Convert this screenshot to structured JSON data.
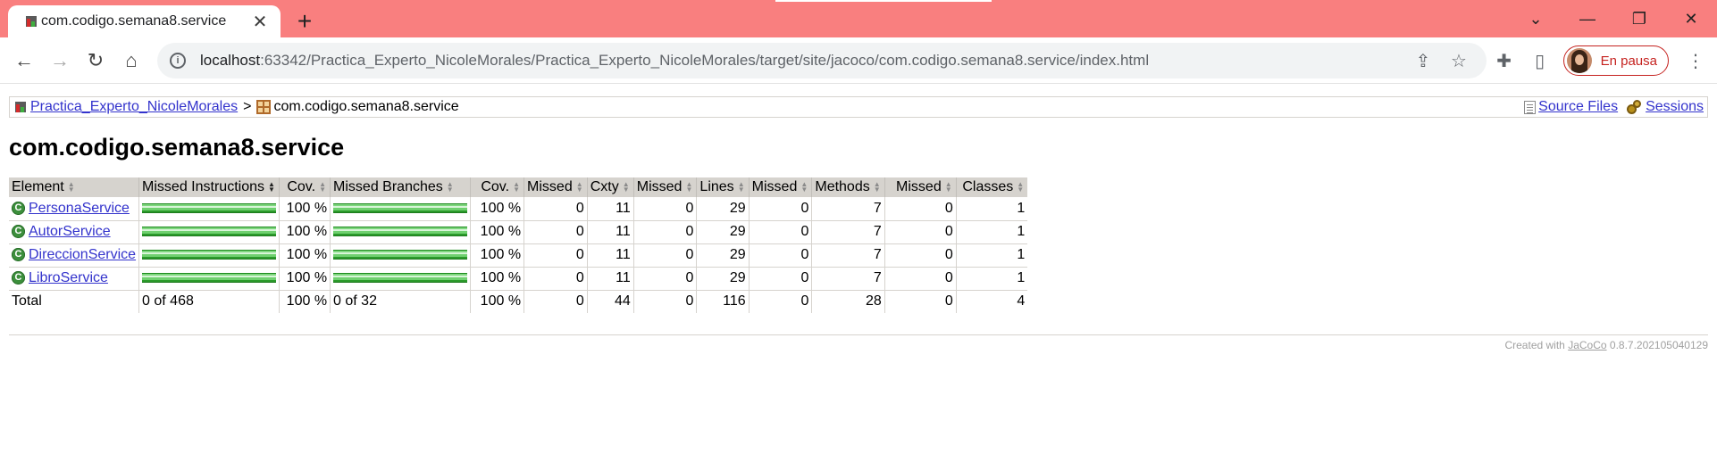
{
  "browser": {
    "tab_title": "com.codigo.semana8.service",
    "url_host": "localhost",
    "url_rest": ":63342/Practica_Experto_NicoleMorales/Practica_Experto_NicoleMorales/target/site/jacoco/com.codigo.semana8.service/index.html",
    "profile_status": "En pausa",
    "accent_color": "#f97f7f"
  },
  "breadcrumb": {
    "root": "Practica_Experto_NicoleMorales",
    "separator": ">",
    "current": "com.codigo.semana8.service",
    "source_files": "Source Files",
    "sessions": "Sessions"
  },
  "title": "com.codigo.semana8.service",
  "table": {
    "headers": [
      "Element",
      "Missed Instructions",
      "Cov.",
      "Missed Branches",
      "Cov.",
      "Missed",
      "Cxty",
      "Missed",
      "Lines",
      "Missed",
      "Methods",
      "Missed",
      "Classes"
    ],
    "rows": [
      {
        "name": "PersonaService",
        "instr_cov_fraction": 1.0,
        "instr_cov": "100 %",
        "branch_cov_fraction": 1.0,
        "branch_cov": "100 %",
        "missed_cxty": "0",
        "cxty": "11",
        "missed_lines": "0",
        "lines": "29",
        "missed_methods": "0",
        "methods": "7",
        "missed_classes": "0",
        "classes": "1"
      },
      {
        "name": "AutorService",
        "instr_cov_fraction": 1.0,
        "instr_cov": "100 %",
        "branch_cov_fraction": 1.0,
        "branch_cov": "100 %",
        "missed_cxty": "0",
        "cxty": "11",
        "missed_lines": "0",
        "lines": "29",
        "missed_methods": "0",
        "methods": "7",
        "missed_classes": "0",
        "classes": "1"
      },
      {
        "name": "DireccionService",
        "instr_cov_fraction": 1.0,
        "instr_cov": "100 %",
        "branch_cov_fraction": 1.0,
        "branch_cov": "100 %",
        "missed_cxty": "0",
        "cxty": "11",
        "missed_lines": "0",
        "lines": "29",
        "missed_methods": "0",
        "methods": "7",
        "missed_classes": "0",
        "classes": "1"
      },
      {
        "name": "LibroService",
        "instr_cov_fraction": 1.0,
        "instr_cov": "100 %",
        "branch_cov_fraction": 1.0,
        "branch_cov": "100 %",
        "missed_cxty": "0",
        "cxty": "11",
        "missed_lines": "0",
        "lines": "29",
        "missed_methods": "0",
        "methods": "7",
        "missed_classes": "0",
        "classes": "1"
      }
    ],
    "total": {
      "label": "Total",
      "instr": "0 of 468",
      "instr_cov": "100 %",
      "branch": "0 of 32",
      "branch_cov": "100 %",
      "missed_cxty": "0",
      "cxty": "44",
      "missed_lines": "0",
      "lines": "116",
      "missed_methods": "0",
      "methods": "28",
      "missed_classes": "0",
      "classes": "4"
    }
  },
  "footer": {
    "prefix": "Created with",
    "link": "JaCoCo",
    "version": "0.8.7.202105040129"
  }
}
